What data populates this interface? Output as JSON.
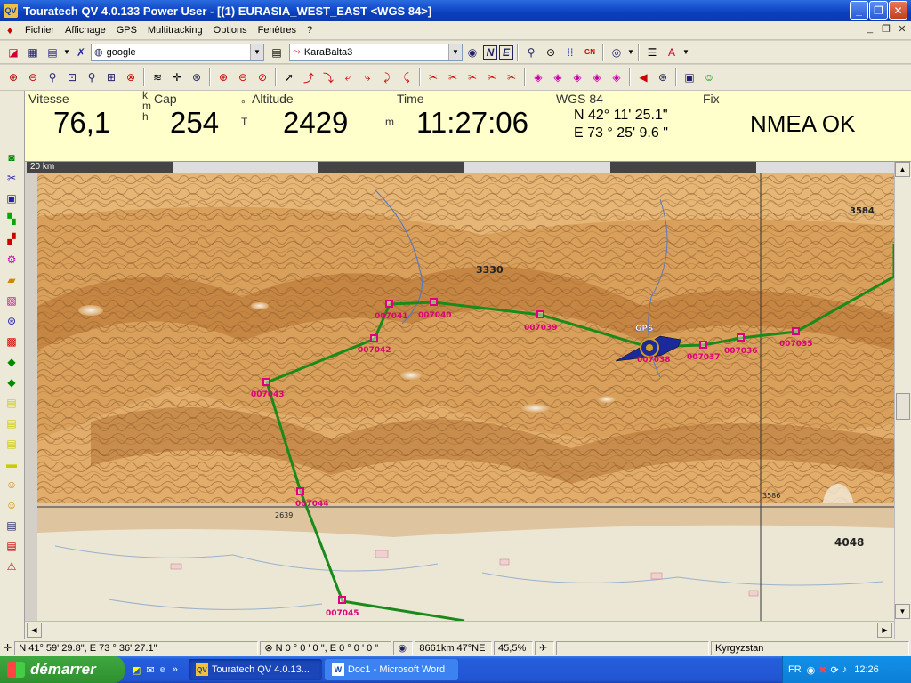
{
  "window": {
    "title": "Touratech QV 4.0.133 Power User - [(1) EURASIA_WEST_EAST <WGS 84>]",
    "app_icon": "QV"
  },
  "menu": [
    "Fichier",
    "Affichage",
    "GPS",
    "Multitracking",
    "Options",
    "Fenêtres",
    "?"
  ],
  "toolbar1": {
    "map_source": "google",
    "track_name": "KaraBalta3"
  },
  "gps": {
    "vitesse_label": "Vitesse",
    "vitesse": "76,1",
    "vitesse_unit_top": "k",
    "vitesse_unit_mid": "m",
    "vitesse_unit_bot": "h",
    "cap_label": "Cap",
    "cap": "254",
    "cap_unit_top": "°",
    "cap_unit_bot": "T",
    "altitude_label": "Altitude",
    "altitude": "2429",
    "altitude_unit": "m",
    "time_label": "Time",
    "time": "11:27:06",
    "datum_label": "WGS 84",
    "lat": "N 42° 11' 25.1\"",
    "lon": "E 73 °  25' 9.6 \"",
    "fix_label": "Fix",
    "fix": "NMEA OK"
  },
  "map": {
    "scale_label": "20 km",
    "gps_label": "GPS",
    "waypoints": [
      "007035",
      "007036",
      "007037",
      "007038",
      "007039",
      "007040",
      "007041",
      "007042",
      "007043",
      "007044",
      "007045"
    ],
    "peaks": [
      "3330",
      "3584",
      "4048",
      "3586",
      "2639"
    ]
  },
  "status": {
    "position": "N 41° 59' 29.8\", E 73 ° 36' 27.1\"",
    "offset": "N 0 ° 0 ' 0   \", E 0 ° 0 ' 0   \"",
    "distance": "8661km 47°NE",
    "zoom": "45,5%",
    "region": "Kyrgyzstan"
  },
  "taskbar": {
    "start": "démarrer",
    "tasks": [
      "Touratech QV 4.0.13...",
      "Doc1 - Microsoft Word"
    ],
    "lang": "FR",
    "clock": "12:26"
  },
  "colors": {
    "track": "#1a8a1a",
    "waypoint": "#e0007a",
    "gps_marker": "#1a2a9a",
    "panel_bg": "#ffffcc"
  }
}
